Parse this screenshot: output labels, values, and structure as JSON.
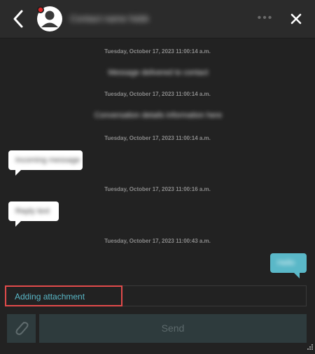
{
  "header": {
    "contact_name": "Contact name hidden",
    "more_label": "•••"
  },
  "messages": [
    {
      "type": "timestamp",
      "text": "Tuesday, October 17, 2023 11:00:14 a.m."
    },
    {
      "type": "system",
      "text": "Message delivered to contact"
    },
    {
      "type": "timestamp",
      "text": "Tuesday, October 17, 2023 11:00:14 a.m."
    },
    {
      "type": "system",
      "text": "Conversation details information here"
    },
    {
      "type": "timestamp",
      "text": "Tuesday, October 17, 2023 11:00:14 a.m."
    },
    {
      "type": "incoming",
      "text": "Incoming message"
    },
    {
      "type": "timestamp",
      "text": "Tuesday, October 17, 2023 11:00:16 a.m."
    },
    {
      "type": "incoming",
      "text": "Reply text"
    },
    {
      "type": "timestamp",
      "text": "Tuesday, October 17, 2023 11:00:43 a.m."
    },
    {
      "type": "outgoing",
      "text": "Hello"
    }
  ],
  "status": {
    "text": "Adding attachment"
  },
  "composer": {
    "send_label": "Send"
  },
  "colors": {
    "background": "#222222",
    "header": "#2b2b2b",
    "accent": "#5ab8c8",
    "highlight": "#e24b4b"
  }
}
